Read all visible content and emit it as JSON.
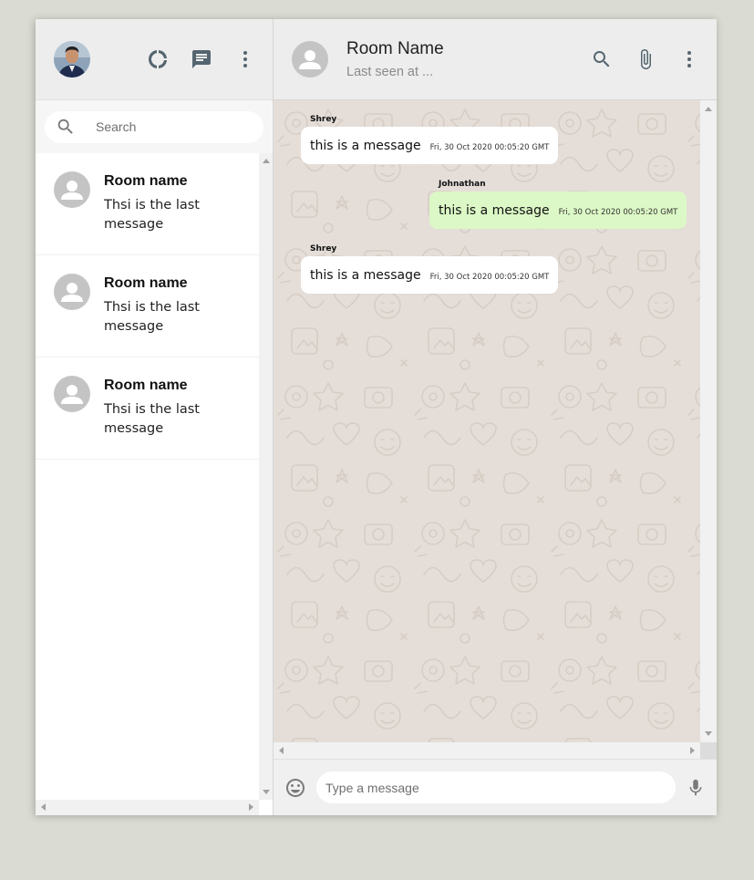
{
  "sidebar": {
    "search_placeholder": "Search",
    "icons": [
      "donut-large-icon",
      "chat-icon",
      "more-vert-icon"
    ],
    "rooms": [
      {
        "name": "Room name",
        "last_message": "Thsi is the last message"
      },
      {
        "name": "Room name",
        "last_message": "Thsi is the last message"
      },
      {
        "name": "Room name",
        "last_message": "Thsi is the last message"
      }
    ]
  },
  "chat": {
    "room_name": "Room Name",
    "last_seen": "Last seen at ...",
    "icons": [
      "search-icon",
      "attach-file-icon",
      "more-vert-icon"
    ],
    "messages": [
      {
        "sender": "Shrey",
        "text": "this is a message",
        "timestamp": "Fri, 30 Oct 2020 00:05:20 GMT",
        "mine": false
      },
      {
        "sender": "Johnathan",
        "text": "this is a message",
        "timestamp": "Fri, 30 Oct 2020 00:05:20 GMT",
        "mine": true
      },
      {
        "sender": "Shrey",
        "text": "this is a message",
        "timestamp": "Fri, 30 Oct 2020 00:05:20 GMT",
        "mine": false
      }
    ],
    "input_placeholder": "Type a message"
  },
  "colors": {
    "app_background": "#dadbd3",
    "header_background": "#ededed",
    "chat_wallpaper": "#e5ded8",
    "own_bubble": "#dcf8c6",
    "other_bubble": "#ffffff"
  }
}
